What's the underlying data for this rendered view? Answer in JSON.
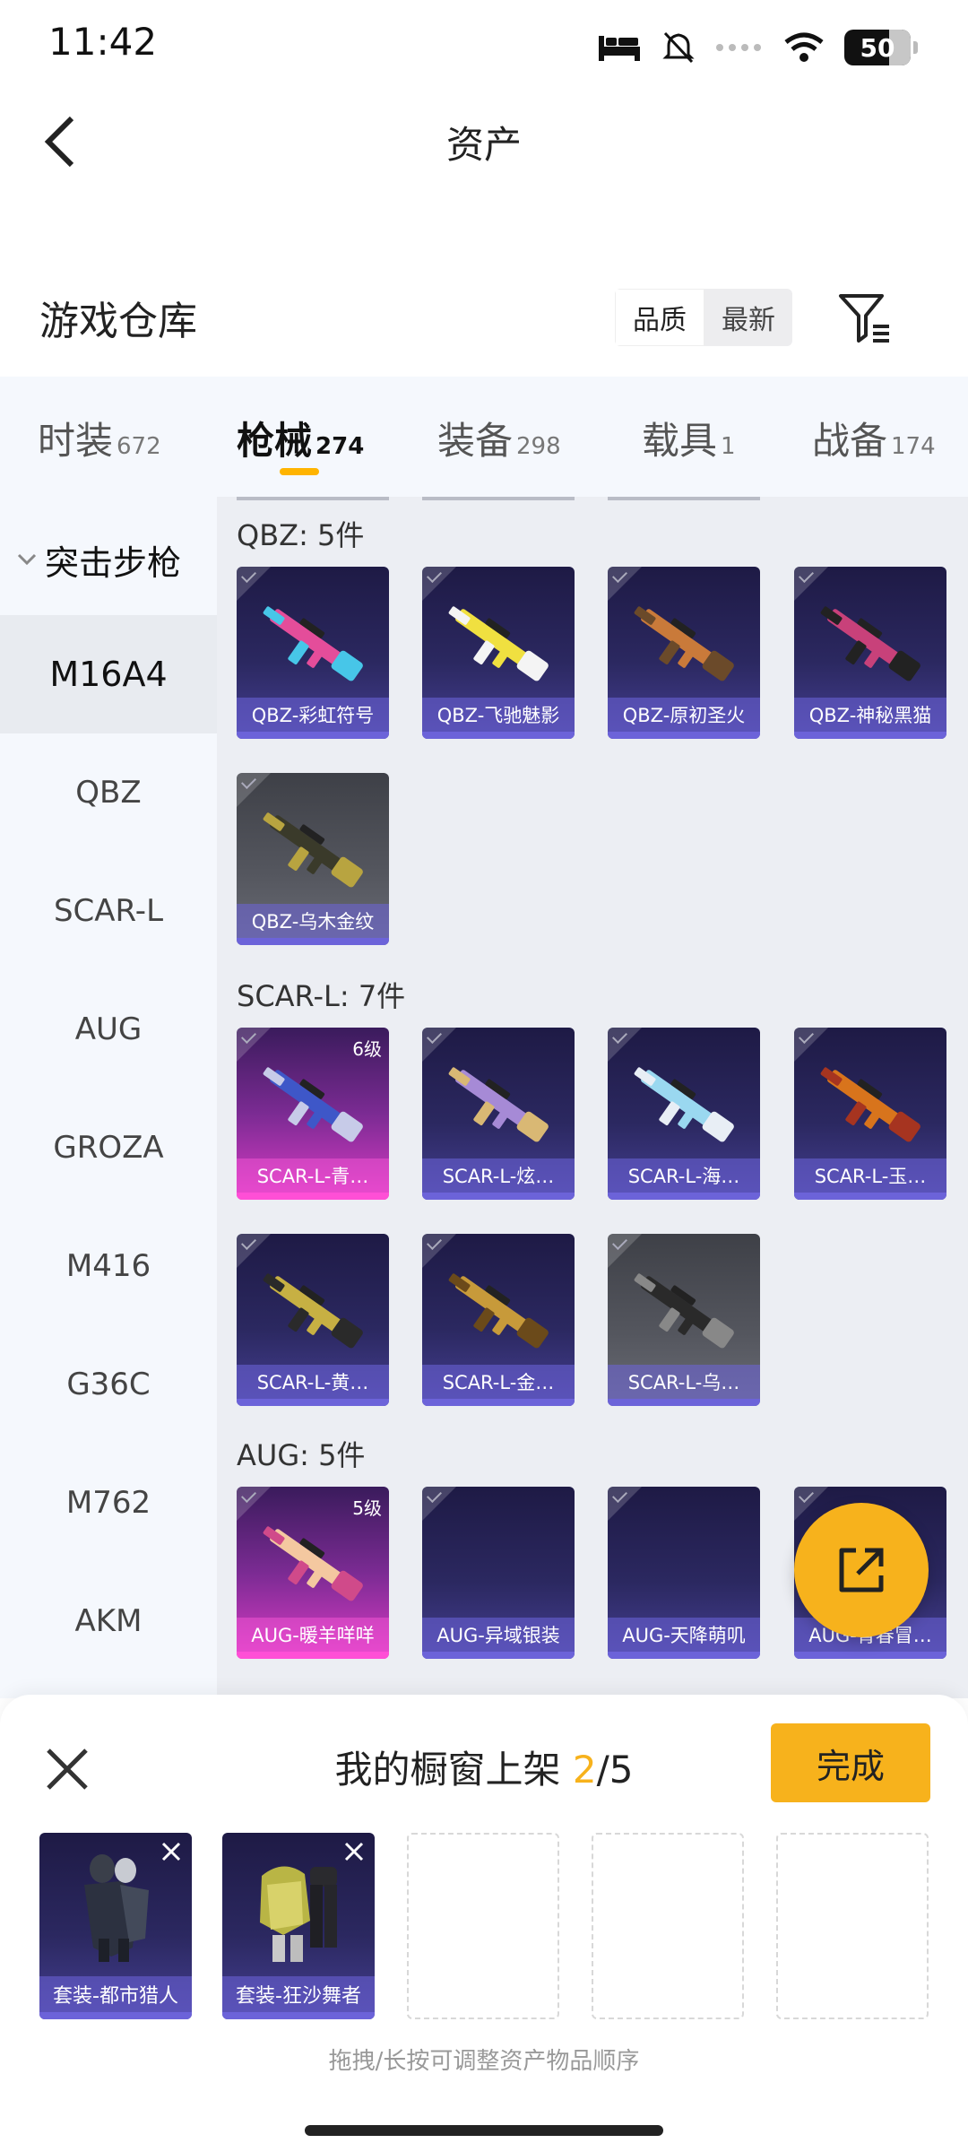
{
  "status": {
    "time": "11:42",
    "battery": "50"
  },
  "header": {
    "title": "资产"
  },
  "section": {
    "title": "游戏仓库",
    "sort_quality": "品质",
    "sort_newest": "最新"
  },
  "tabs": [
    {
      "label": "时装",
      "count": "672"
    },
    {
      "label": "枪械",
      "count": "274"
    },
    {
      "label": "装备",
      "count": "298"
    },
    {
      "label": "载具",
      "count": "1"
    },
    {
      "label": "战备",
      "count": "174"
    }
  ],
  "sidebar": {
    "group": "突击步枪",
    "items": [
      "M16A4",
      "QBZ",
      "SCAR-L",
      "AUG",
      "GROZA",
      "M416",
      "G36C",
      "M762",
      "AKM"
    ]
  },
  "groups": [
    {
      "title": "QBZ: 5件",
      "items": [
        {
          "name": "QBZ-彩虹符号",
          "rarity": "blue",
          "level": ""
        },
        {
          "name": "QBZ-飞驰魅影",
          "rarity": "blue",
          "level": ""
        },
        {
          "name": "QBZ-原初圣火",
          "rarity": "blue",
          "level": ""
        },
        {
          "name": "QBZ-神秘黑猫",
          "rarity": "blue",
          "level": ""
        },
        {
          "name": "QBZ-乌木金纹",
          "rarity": "grey",
          "level": ""
        }
      ]
    },
    {
      "title": "SCAR-L: 7件",
      "items": [
        {
          "name": "SCAR-L-青…",
          "rarity": "pink",
          "level": "6级"
        },
        {
          "name": "SCAR-L-炫…",
          "rarity": "blue",
          "level": ""
        },
        {
          "name": "SCAR-L-海…",
          "rarity": "blue",
          "level": ""
        },
        {
          "name": "SCAR-L-玉…",
          "rarity": "blue",
          "level": ""
        },
        {
          "name": "SCAR-L-黄…",
          "rarity": "blue",
          "level": ""
        },
        {
          "name": "SCAR-L-金…",
          "rarity": "blue",
          "level": ""
        },
        {
          "name": "SCAR-L-乌…",
          "rarity": "grey",
          "level": ""
        }
      ]
    },
    {
      "title": "AUG: 5件",
      "items": [
        {
          "name": "AUG-暖羊咩咩",
          "rarity": "pink",
          "level": "5级"
        },
        {
          "name": "AUG-异域银装",
          "rarity": "blue",
          "level": ""
        },
        {
          "name": "AUG-天降萌叽",
          "rarity": "blue",
          "level": ""
        },
        {
          "name": "AUG-青春冒…",
          "rarity": "blue",
          "level": ""
        }
      ]
    }
  ],
  "showcase": {
    "title_prefix": "我的橱窗上架",
    "current": "2",
    "total": "/5",
    "done_label": "完成",
    "items": [
      "套装-都市猎人",
      "套装-狂沙舞者"
    ],
    "hint": "拖拽/长按可调整资产物品顺序"
  },
  "colors": {
    "accent": "#f7b21c",
    "rare_blue": "#6c63d9",
    "rare_pink": "#ff4fd6"
  }
}
